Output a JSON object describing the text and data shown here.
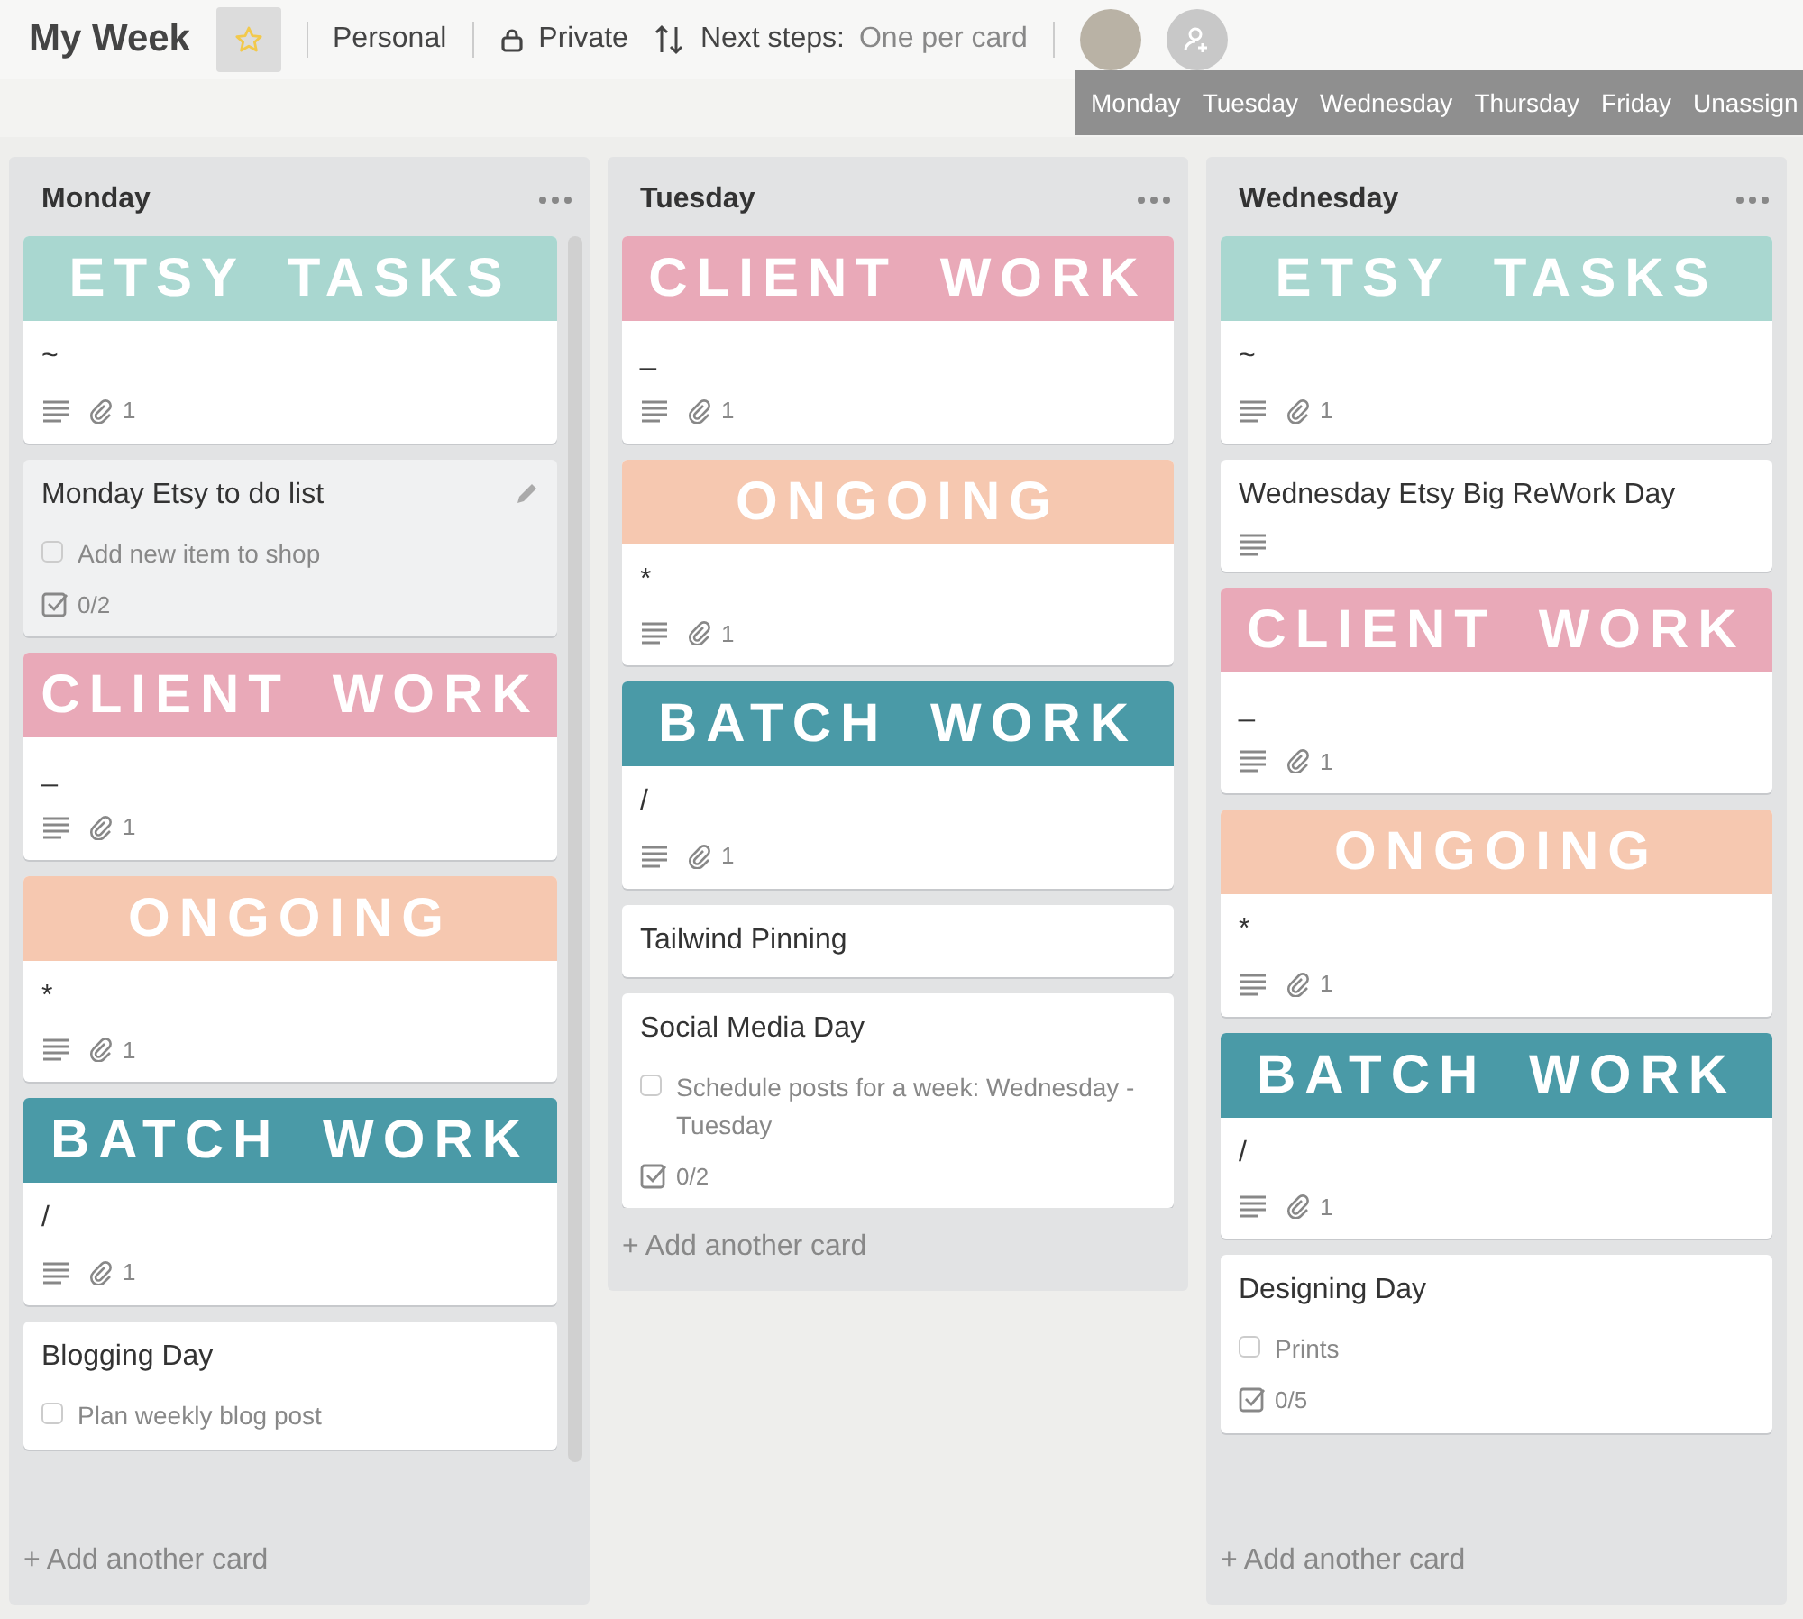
{
  "board": {
    "title": "My Week",
    "starred": true,
    "team": "Personal",
    "visibility": "Private",
    "next_steps_label": "Next steps:",
    "next_steps_value": "One per card"
  },
  "day_filter": [
    {
      "label": "Monday"
    },
    {
      "label": "Tuesday"
    },
    {
      "label": "Wednesday"
    },
    {
      "label": "Thursday"
    },
    {
      "label": "Friday"
    },
    {
      "label": "Unassign"
    }
  ],
  "lists": [
    {
      "title": "Monday",
      "add_card": "+ Add another card",
      "scrollbar": true,
      "cards": [
        {
          "kind": "cover",
          "cover_text": "ETSY TASKS",
          "color": "#a9d7d0",
          "title": "~",
          "description": true,
          "attachments": "1"
        },
        {
          "kind": "checklist",
          "title": "Monday Etsy to do list",
          "hovered": true,
          "item": "Add new item to shop",
          "item_checked": false,
          "progress": "0/2",
          "complete": false
        },
        {
          "kind": "cover",
          "cover_text": "CLIENT WORK",
          "color": "#e9a9b8",
          "title": "_",
          "description": true,
          "attachments": "1"
        },
        {
          "kind": "cover",
          "cover_text": "ONGOING",
          "color": "#f6c8b0",
          "title": "*",
          "description": true,
          "attachments": "1"
        },
        {
          "kind": "cover",
          "cover_text": "BATCH WORK",
          "color": "#4a9aa7",
          "title": "/",
          "description": true,
          "attachments": "1"
        },
        {
          "kind": "checklist",
          "title": "Blogging Day",
          "hovered": false,
          "item": "Plan weekly blog post",
          "item_checked": false
        }
      ]
    },
    {
      "title": "Tuesday",
      "add_card": "+ Add another card",
      "cards": [
        {
          "kind": "cover",
          "cover_text": "CLIENT WORK",
          "color": "#e9a9b8",
          "title": "_",
          "description": true,
          "attachments": "1"
        },
        {
          "kind": "cover",
          "cover_text": "ONGOING",
          "color": "#f6c8b0",
          "title": "*",
          "description": true,
          "attachments": "1"
        },
        {
          "kind": "cover",
          "cover_text": "BATCH WORK",
          "color": "#4a9aa7",
          "title": "/",
          "description": true,
          "attachments": "1"
        },
        {
          "kind": "plain",
          "title": "Tailwind Pinning",
          "description": false
        },
        {
          "kind": "checklist",
          "title": "Social Media Day",
          "hovered": false,
          "item": "Schedule posts for a week: Wednesday - Tuesday",
          "item_checked": false,
          "progress": "0/2",
          "complete": false
        }
      ]
    },
    {
      "title": "Wednesday",
      "add_card": "+ Add another card",
      "cards": [
        {
          "kind": "cover",
          "cover_text": "ETSY TASKS",
          "color": "#a9d7d0",
          "title": "~",
          "description": true,
          "attachments": "1"
        },
        {
          "kind": "plain",
          "title": "Wednesday Etsy Big ReWork Day",
          "description": true
        },
        {
          "kind": "cover",
          "cover_text": "CLIENT WORK",
          "color": "#e9a9b8",
          "title": "_",
          "description": true,
          "attachments": "1"
        },
        {
          "kind": "cover",
          "cover_text": "ONGOING",
          "color": "#f6c8b0",
          "title": "*",
          "description": true,
          "attachments": "1"
        },
        {
          "kind": "cover",
          "cover_text": "BATCH WORK",
          "color": "#4a9aa7",
          "title": "/",
          "description": true,
          "attachments": "1"
        },
        {
          "kind": "checklist",
          "title": "Designing Day",
          "hovered": false,
          "item": "Prints",
          "item_checked": false,
          "progress": "0/5",
          "complete": false
        }
      ]
    }
  ]
}
